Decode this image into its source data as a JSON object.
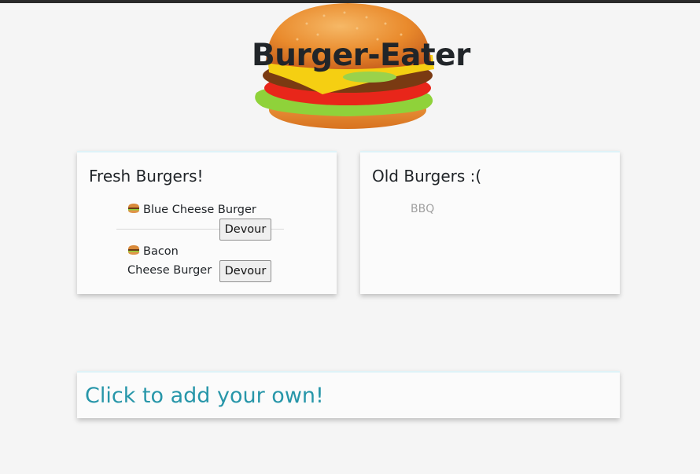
{
  "header": {
    "title": "Burger-Eater",
    "logo_icon": "hamburger-logo-icon"
  },
  "fresh": {
    "title": "Fresh Burgers!",
    "items": [
      {
        "name": "Blue Cheese Burger",
        "button_label": "Devour"
      },
      {
        "name": "Bacon Cheese Burger",
        "button_label": "Devour"
      }
    ]
  },
  "old": {
    "title": "Old Burgers :(",
    "items": [
      {
        "name": "BBQ"
      }
    ]
  },
  "add": {
    "label": "Click to add your own!"
  },
  "colors": {
    "link": "#2796a9",
    "background": "#f5f5f5",
    "eaten_text": "#a0a0a0"
  }
}
